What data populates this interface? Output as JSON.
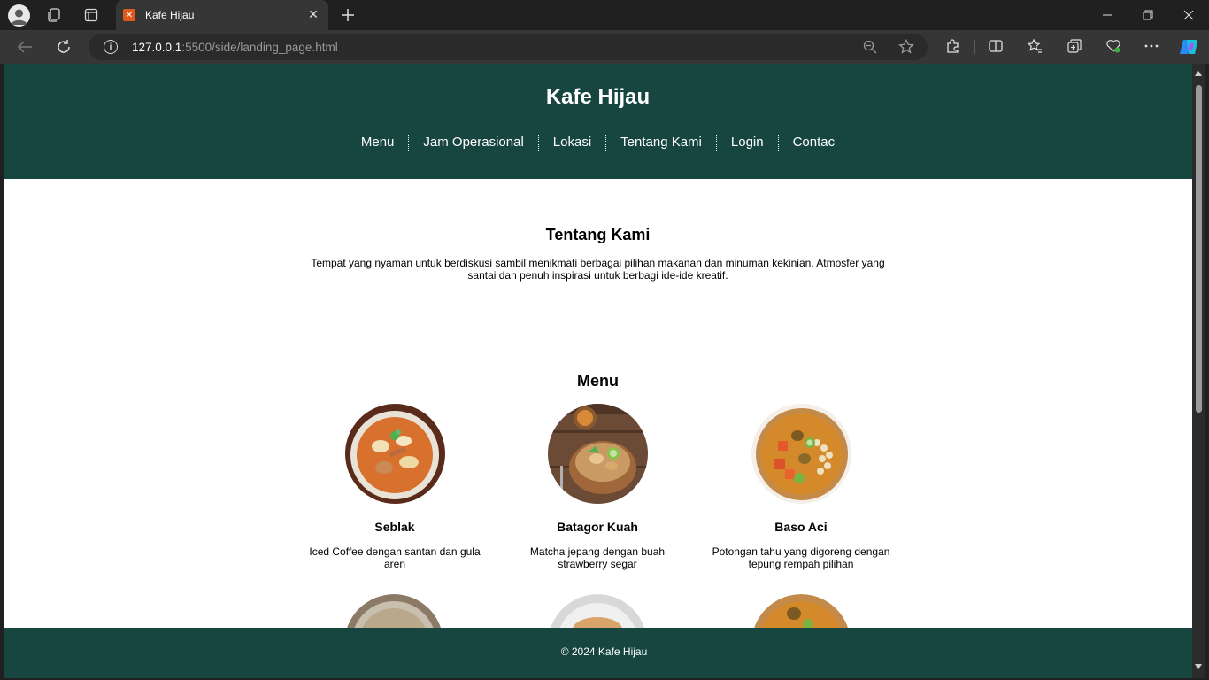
{
  "browser": {
    "tab_title": "Kafe Hijau",
    "url_host": "127.0.0.1",
    "url_path": ":5500/side/landing_page.html"
  },
  "site": {
    "title": "Kafe Hijau",
    "nav": [
      "Menu",
      "Jam Operasional",
      "Lokasi",
      "Tentang Kami",
      "Login",
      "Contac"
    ]
  },
  "about": {
    "heading": "Tentang Kami",
    "text": "Tempat yang nyaman untuk berdiskusi sambil menikmati berbagai pilihan makanan dan minuman kekinian. Atmosfer yang santai dan penuh inspirasi untuk berbagi ide-ide kreatif."
  },
  "menu": {
    "heading": "Menu",
    "items": [
      {
        "name": "Seblak",
        "description": "Iced Coffee dengan santan dan gula aren"
      },
      {
        "name": "Batagor Kuah",
        "description": "Matcha jepang dengan buah strawberry segar"
      },
      {
        "name": "Baso Aci",
        "description": "Potongan tahu yang digoreng dengan tepung rempah pilihan"
      }
    ]
  },
  "footer": {
    "copyright": "© 2024 Kafe Hijau"
  }
}
